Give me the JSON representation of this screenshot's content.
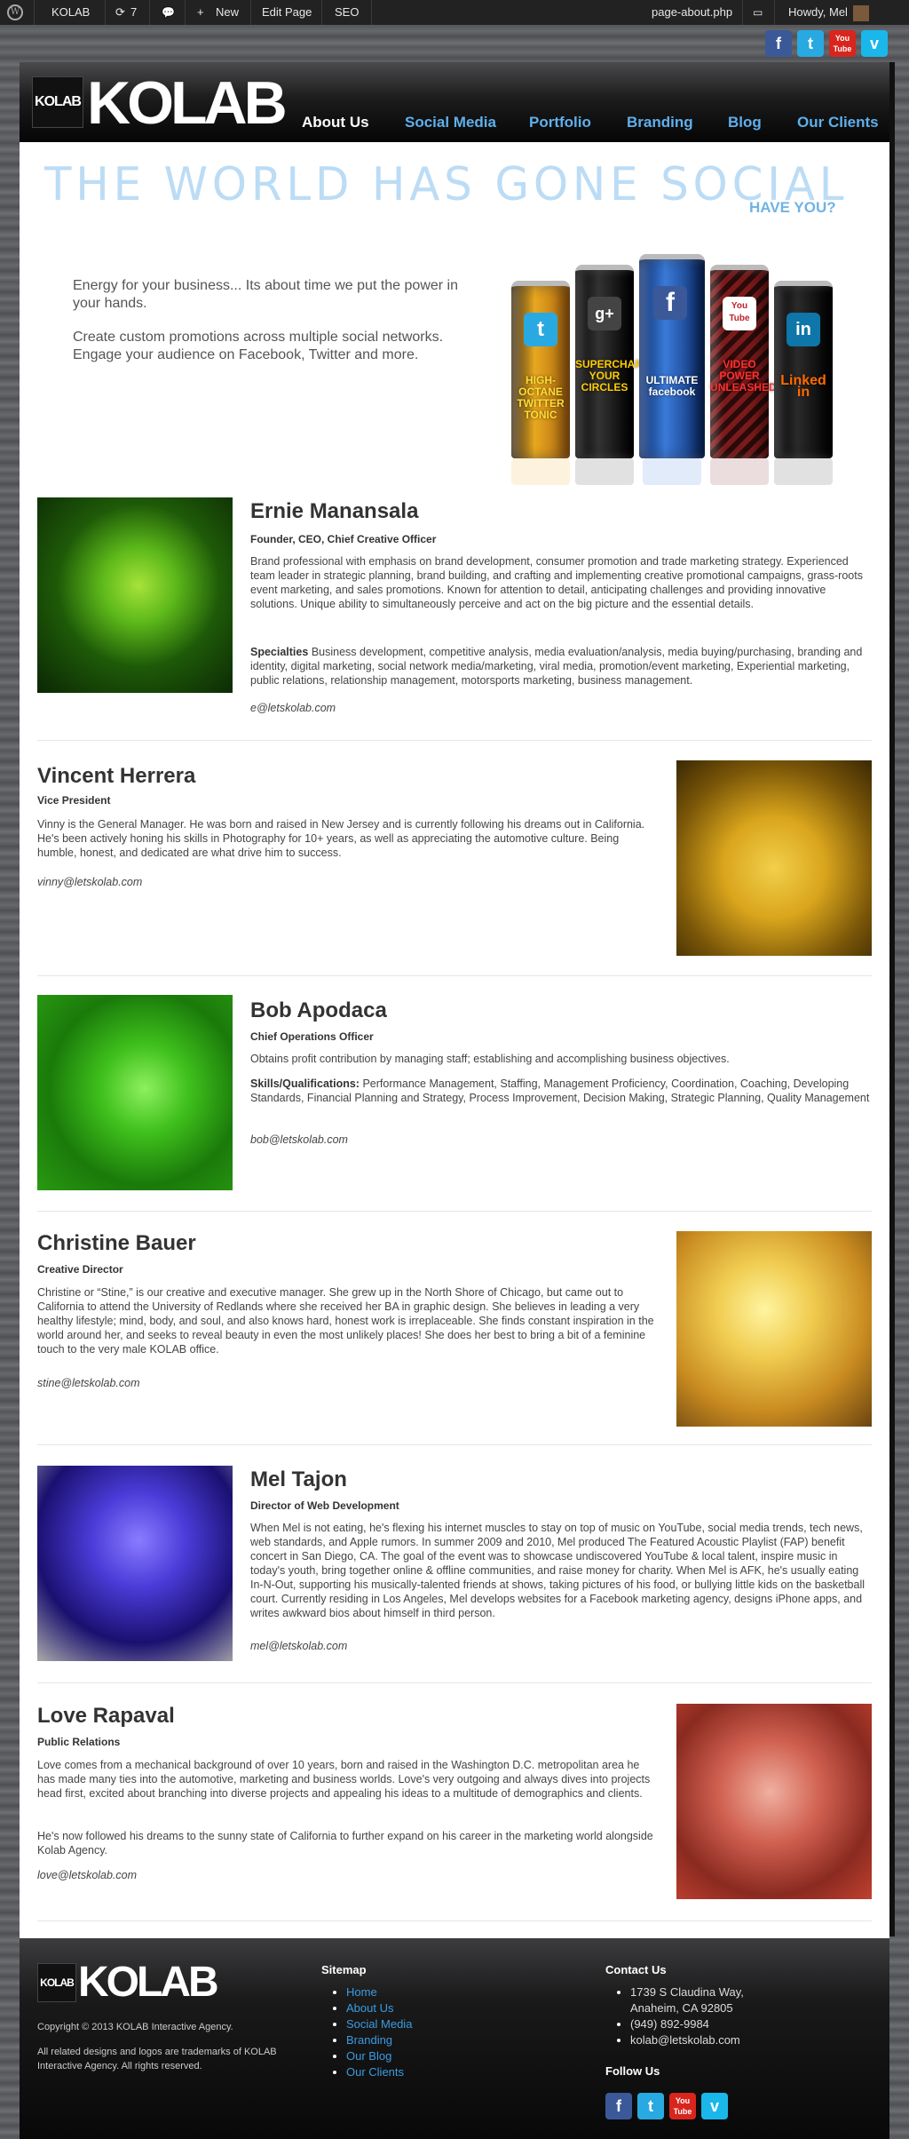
{
  "adminbar": {
    "site": "KOLAB",
    "updates": "7",
    "new": "New",
    "edit": "Edit Page",
    "seo": "SEO",
    "file": "page-about.php",
    "howdy": "Howdy, Mel"
  },
  "social": {
    "facebook": "f",
    "twitter": "t",
    "youtube": "You Tube",
    "vimeo": "v"
  },
  "brand": {
    "mark": "KOLAB",
    "name": "KOLAB"
  },
  "nav": [
    "About Us",
    "Social Media",
    "Portfolio",
    "Branding",
    "Blog",
    "Our Clients"
  ],
  "hero": {
    "headline": "THE WORLD HAS GONE SOCIAL",
    "tagline": "HAVE YOU?",
    "p1": "Energy for your business... Its about time we put the power in your hands.",
    "p2": "Create custom promotions across multiple social networks. Engage your audience on Facebook, Twitter and more."
  },
  "cans": [
    {
      "icon": "t",
      "label": "HIGH-OCTANE TWITTER TONIC",
      "color": "#e8a820"
    },
    {
      "icon": "g+",
      "label": "SUPERCHARGE YOUR CIRCLES",
      "color": "#1a1a1a"
    },
    {
      "icon": "f",
      "label": "ULTIMATE facebook",
      "color": "#2a5db0"
    },
    {
      "icon": "You Tube",
      "label": "VIDEO POWER UNLEASHED",
      "color": "#c0202a"
    },
    {
      "icon": "in",
      "label": "Linked in",
      "color": "#1a1a1a"
    }
  ],
  "team": [
    {
      "name": "Ernie Manansala",
      "role": "Founder, CEO, Chief Creative Officer",
      "bio": "Brand professional with emphasis on brand development, consumer promotion and trade marketing strategy. Experienced team leader in strategic planning, brand building, and crafting and implementing creative promotional campaigns, grass-roots event marketing, and sales promotions. Known for attention to detail, anticipating challenges and providing innovative solutions. Unique ability to simultaneously perceive and act on the big picture and the essential details.",
      "skills_label": "Specialties",
      "skills": "Business development, competitive analysis, media evaluation/analysis, media buying/purchasing, branding and identity, digital marketing, social network media/marketing, viral media, promotion/event marketing, Experiential marketing, public relations, relationship management, motorsports marketing, business management.",
      "email": "e@letskolab.com"
    },
    {
      "name": "Vincent Herrera",
      "role": "Vice President",
      "bio": "Vinny is the General Manager. He was born and raised in New Jersey and is currently following his dreams out in California. He's been actively honing his skills in Photography for 10+ years, as well as appreciating the automotive culture. Being humble, honest, and dedicated are what drive him to success.",
      "email": "vinny@letskolab.com"
    },
    {
      "name": "Bob Apodaca",
      "role": "Chief Operations Officer",
      "bio": "Obtains profit contribution by managing staff; establishing and accomplishing business objectives.",
      "skills_label": "Skills/Qualifications:",
      "skills": "Performance Management, Staffing, Management Proficiency, Coordination, Coaching, Developing Standards, Financial Planning and Strategy, Process Improvement, Decision Making, Strategic Planning, Quality Management",
      "email": "bob@letskolab.com"
    },
    {
      "name": "Christine Bauer",
      "role": "Creative Director",
      "bio": "Christine or “Stine,” is our creative and executive manager. She grew up in the North Shore of Chicago, but came out to California to attend the University of Redlands where she received her BA in graphic design. She believes in leading a very healthy lifestyle; mind, body, and soul, and also knows hard, honest work is irreplaceable. She finds constant inspiration in the world around her, and seeks to reveal beauty in even the most unlikely places! She does her best to bring a bit of a feminine touch to the very male KOLAB office.",
      "email": "stine@letskolab.com"
    },
    {
      "name": "Mel Tajon",
      "role": "Director of Web Development",
      "bio": "When Mel is not eating, he's flexing his internet muscles to stay on top of music on YouTube, social media trends, tech news, web standards, and Apple rumors. In summer 2009 and 2010, Mel produced The Featured Acoustic Playlist (FAP) benefit concert in San Diego, CA. The goal of the event was to showcase undiscovered YouTube & local talent, inspire music in today's youth, bring together online & offline communities, and raise money for charity. When Mel is AFK, he's usually eating In-N-Out, supporting his musically-talented friends at shows, taking pictures of his food, or bullying little kids on the basketball court. Currently residing in Los Angeles, Mel develops websites for a Facebook marketing agency, designs iPhone apps, and writes awkward bios about himself in third person.",
      "email": "mel@letskolab.com"
    },
    {
      "name": "Love Rapaval",
      "role": "Public Relations",
      "bio": "Love comes from a mechanical background of over 10 years, born and raised in the Washington D.C. metropolitan area he has made many ties into the automotive, marketing and business worlds. Love's very outgoing and always dives into projects head first, excited about branching into diverse projects and appealing his ideas to a multitude of demographics and clients.",
      "bio2": "He's now followed his dreams to the sunny state of California to further expand on his career in the marketing world alongside Kolab Agency.",
      "email": "love@letskolab.com"
    }
  ],
  "footer": {
    "copyright": "Copyright © 2013 KOLAB Interactive Agency.",
    "trademark": "All related designs and logos are trademarks of KOLAB Interactive Agency. All rights reserved.",
    "sitemap_title": "Sitemap",
    "sitemap": [
      "Home",
      "About Us",
      "Social Media",
      "Branding",
      "Our Blog",
      "Our Clients"
    ],
    "contact_title": "Contact Us",
    "address1": "1739 S Claudina Way,",
    "address2": "Anaheim, CA 92805",
    "phone": "(949) 892-9984",
    "email": "kolab@letskolab.com",
    "follow_title": "Follow Us"
  },
  "colors": {
    "accent": "#3c9be0",
    "nav_link": "#5fb0ec",
    "headline": "#bcdcf5"
  }
}
